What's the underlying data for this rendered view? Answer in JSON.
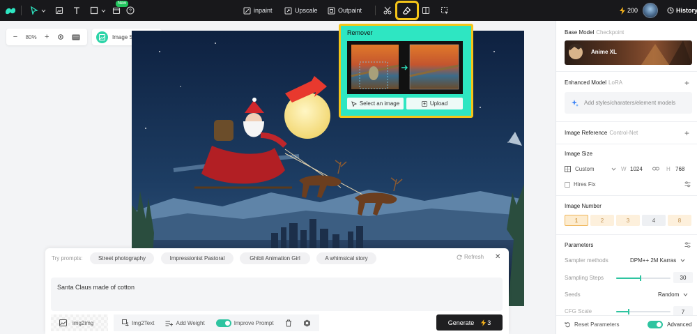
{
  "topbar": {
    "new_badge": "New",
    "inpaint": "inpaint",
    "upscale": "Upscale",
    "outpaint": "Outpaint",
    "credits": "200",
    "history": "History"
  },
  "canvas": {
    "zoom": "80%",
    "showcase": "Image Showcase"
  },
  "remover": {
    "title": "Remover",
    "select_image": "Select an image",
    "upload": "Upload"
  },
  "prompt": {
    "try_label": "Try prompts:",
    "chips": [
      "Street photography",
      "Impressionist Pastoral",
      "Ghibli Animation Girl",
      "A whimsical story"
    ],
    "refresh": "Refresh",
    "text": "Santa Claus made of cotton",
    "img2img": "img2img",
    "img2text": "Img2Text",
    "add_weight": "Add Weight",
    "improve_prompt": "Improve Prompt",
    "generate": "Generate",
    "generate_cost": "3"
  },
  "right": {
    "base_model": "Base Model",
    "base_model_sub": "Checkpoint",
    "model_name": "Anime XL",
    "enhanced_model": "Enhanced Model",
    "enhanced_model_sub": "LoRA",
    "lora_placeholder": "Add styles/charaters/element models",
    "image_reference": "Image Reference",
    "image_reference_sub": "Control-Net",
    "image_size": "Image Size",
    "size_preset": "Custom",
    "w_label": "W",
    "width": "1024",
    "h_label": "H",
    "height": "768",
    "hires_fix": "Hires Fix",
    "image_number": "Image Number",
    "numbers": [
      "1",
      "2",
      "3",
      "4",
      "8"
    ],
    "parameters": "Parameters",
    "sampler_label": "Sampler methods",
    "sampler_value": "DPM++ 2M Karras",
    "steps_label": "Sampling Steps",
    "steps_value": "30",
    "seeds_label": "Seeds",
    "seeds_value": "Random",
    "cfg_label": "CFG Scale",
    "cfg_value": "7",
    "reset": "Reset Parameters",
    "advanced": "Advanced"
  },
  "colors": {
    "accent": "#2ec4a0",
    "highlight": "#f5c518",
    "remover_bg": "#2ee6c2",
    "topbar_bg": "#18181b"
  }
}
